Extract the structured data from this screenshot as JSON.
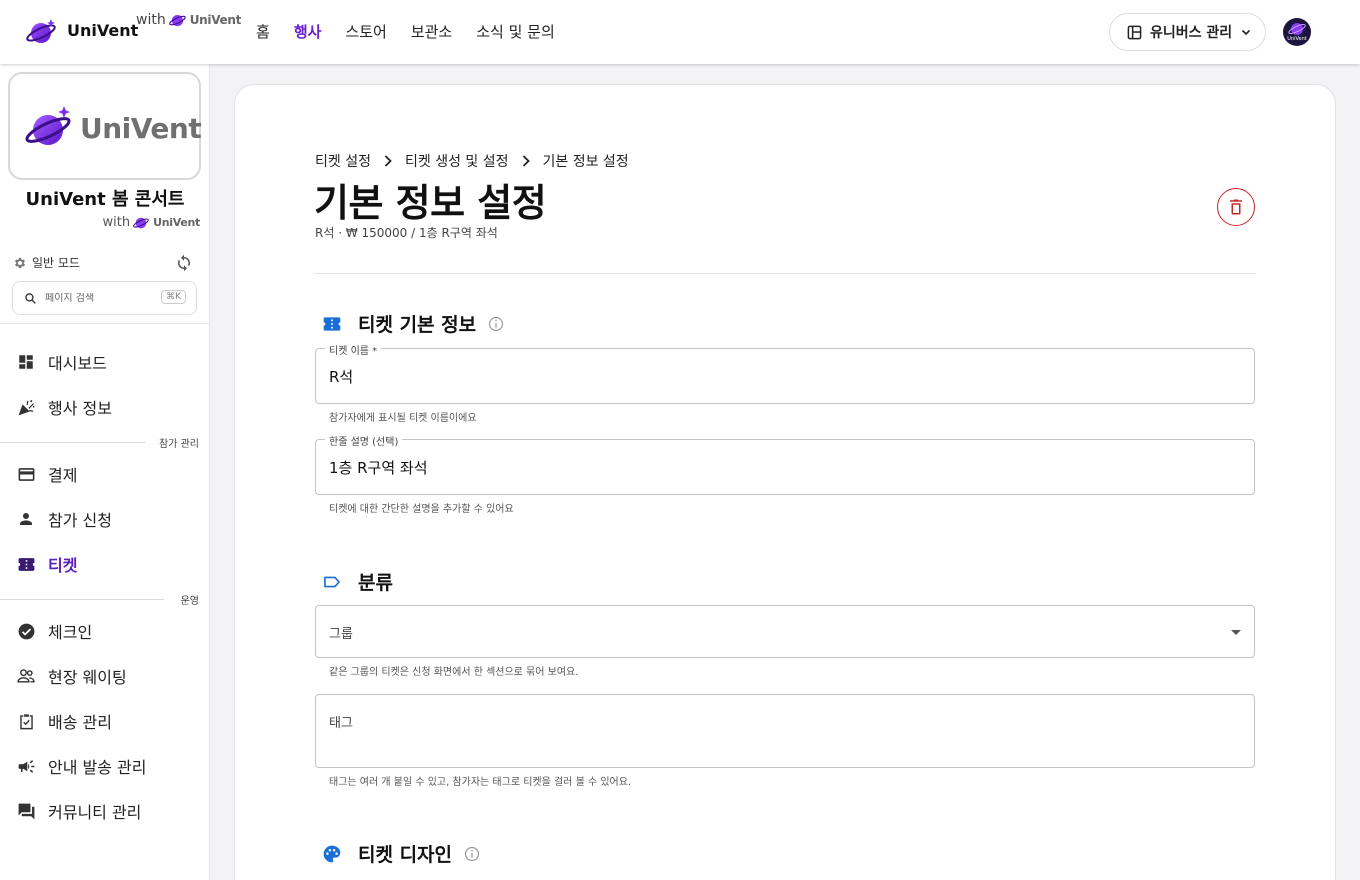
{
  "header": {
    "brand": "UniVent",
    "with_text": "with",
    "with_logo_text": "UniVent",
    "nav": [
      "홈",
      "행사",
      "스토어",
      "보관소",
      "소식 및 문의"
    ],
    "nav_active_index": 1,
    "universe_button": "유니버스 관리",
    "avatar_text": "UniVent"
  },
  "sidebar": {
    "thumb_text": "UniVent",
    "event_title": "UniVent 봄 콘서트",
    "with_text": "with",
    "with_logo_text": "UniVent",
    "mode_label": "일반 모드",
    "search_placeholder": "페이지 검색",
    "search_shortcut": "⌘K",
    "items_top": [
      {
        "label": "대시보드",
        "icon": "dashboard-icon"
      },
      {
        "label": "행사 정보",
        "icon": "celebration-icon"
      }
    ],
    "section_participants": "참가 관리",
    "items_participants": [
      {
        "label": "결제",
        "icon": "credit-card-icon"
      },
      {
        "label": "참가 신청",
        "icon": "person-icon"
      },
      {
        "label": "티켓",
        "icon": "ticket-icon",
        "active": true
      }
    ],
    "section_operations": "운영",
    "items_operations": [
      {
        "label": "체크인",
        "icon": "check-circle-icon"
      },
      {
        "label": "현장 웨이팅",
        "icon": "people-icon"
      },
      {
        "label": "배송 관리",
        "icon": "clipboard-check-icon"
      },
      {
        "label": "안내 발송 관리",
        "icon": "megaphone-icon"
      },
      {
        "label": "커뮤니티 관리",
        "icon": "forum-icon"
      }
    ]
  },
  "main": {
    "breadcrumbs": [
      "티켓 설정",
      "티켓 생성 및 설정",
      "기본 정보 설정"
    ],
    "title": "기본 정보 설정",
    "subline": "R석 · ₩ 150000 / 1층 R구역 좌석",
    "section_basic": "티켓 기본 정보",
    "ticket_name_label": "티켓 이름 *",
    "ticket_name_value": "R석",
    "ticket_name_helper": "참가자에게 표시될 티켓 이름이에요",
    "desc_label": "한줄 설명 (선택)",
    "desc_value": "1층 R구역 좌석",
    "desc_helper": "티켓에 대한 간단한 설명을 추가할 수 있어요",
    "section_category": "분류",
    "group_placeholder": "그룹",
    "group_helper": "같은 그룹의 티켓은 신청 화면에서 한 섹션으로 묶어 보여요.",
    "tag_placeholder": "태그",
    "tag_helper": "태그는 여러 개 붙일 수 있고, 참가자는 태그로 티켓을 걸러 볼 수 있어요.",
    "section_design": "티켓 디자인"
  },
  "colors": {
    "accent": "#6a1fd0",
    "section_icon": "#1a6fd6",
    "delete": "#c62828"
  }
}
